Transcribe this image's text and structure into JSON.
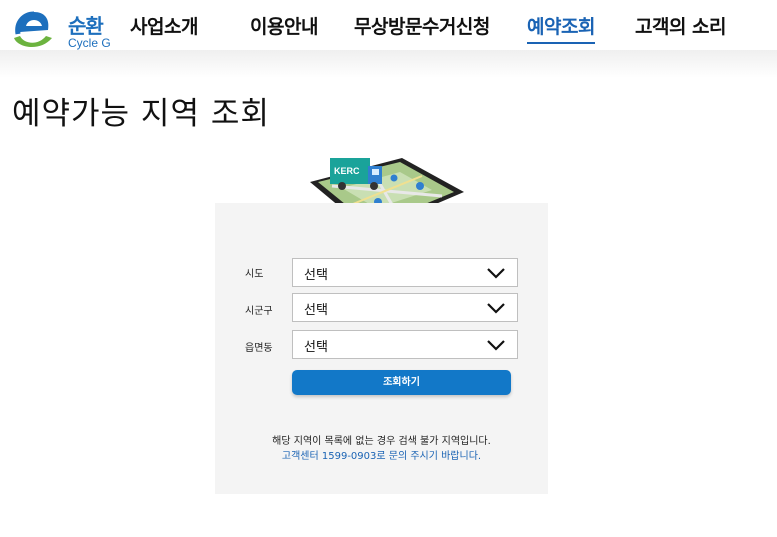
{
  "logo": {
    "name": "순환",
    "sub": "Cycle G"
  },
  "nav": {
    "items": [
      {
        "label": "사업소개"
      },
      {
        "label": "이용안내"
      },
      {
        "label": "무상방문수거신청"
      },
      {
        "label": "예약조회"
      },
      {
        "label": "고객의 소리"
      }
    ],
    "active_index": 3
  },
  "page": {
    "title": "예약가능 지역 조회"
  },
  "illustration": {
    "truck_label": "KERC"
  },
  "form": {
    "fields": [
      {
        "label": "시도",
        "value": "선택"
      },
      {
        "label": "시군구",
        "value": "선택"
      },
      {
        "label": "읍면동",
        "value": "선택"
      }
    ],
    "submit_label": "조회하기"
  },
  "notice": {
    "line1": "해당 지역이 목록에 없는 경우 검색 불가 지역입니다.",
    "line2": "고객센터 1599-0903로 문의 주시기 바랍니다."
  },
  "colors": {
    "accent": "#1a63b4",
    "button": "#1278c8",
    "logo_green": "#6cb33f",
    "panel_bg": "#f4f4f4"
  }
}
